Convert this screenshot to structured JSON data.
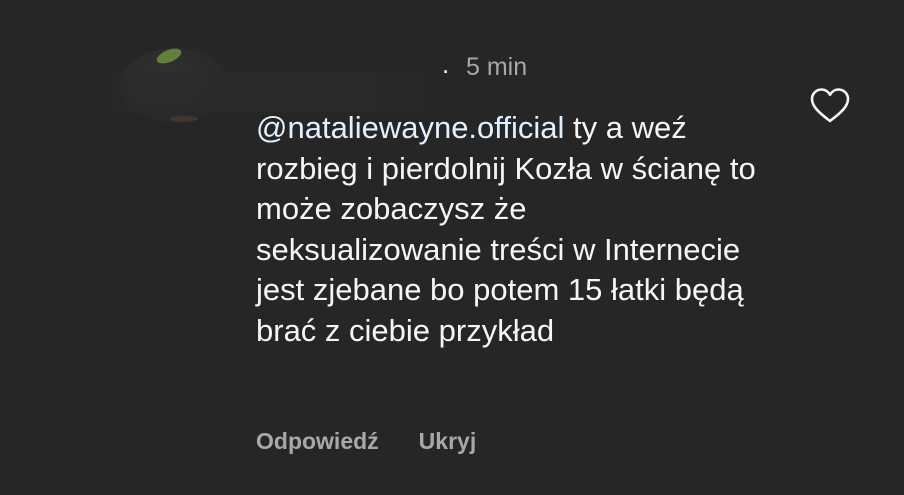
{
  "comment": {
    "time": "5 min",
    "separator": ".",
    "mention": "@nataliewayne.official",
    "body": "ty a weź rozbieg i pierdolnij Kozła w ścianę to może zobaczysz że seksualizowanie treści w Internecie jest zjebane bo potem 15 łatki będą brać z ciebie przykład",
    "actions": {
      "reply": "Odpowiedź",
      "hide": "Ukryj"
    }
  },
  "icons": {
    "like": "heart-outline-icon"
  },
  "colors": {
    "background": "#262626",
    "text": "#f5f5f5",
    "muted": "#a8a8a8",
    "mention": "#e0f1ff"
  }
}
